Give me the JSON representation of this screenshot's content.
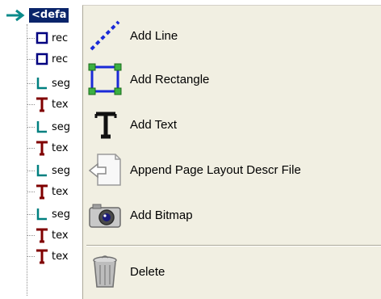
{
  "tree": {
    "root_label": "<defa",
    "rows": [
      {
        "icon": "rect-icon",
        "label": "rec"
      },
      {
        "icon": "rect-icon",
        "label": "rec"
      },
      {
        "icon": "segment-icon",
        "label": "seg"
      },
      {
        "icon": "text-icon",
        "label": "tex"
      },
      {
        "icon": "segment-icon",
        "label": "seg"
      },
      {
        "icon": "text-icon",
        "label": "tex"
      },
      {
        "icon": "segment-icon",
        "label": "seg"
      },
      {
        "icon": "text-icon",
        "label": "tex"
      },
      {
        "icon": "segment-icon",
        "label": "seg"
      },
      {
        "icon": "text-icon",
        "label": "tex"
      },
      {
        "icon": "text-icon",
        "label": "tex"
      }
    ]
  },
  "menu": {
    "items": [
      {
        "label": "Add Line",
        "icon": "line-icon"
      },
      {
        "label": "Add Rectangle",
        "icon": "rectangle-icon"
      },
      {
        "label": "Add Text",
        "icon": "text-icon"
      },
      {
        "label": "Append Page Layout Descr File",
        "icon": "file-append-icon"
      },
      {
        "label": "Add Bitmap",
        "icon": "camera-icon"
      },
      {
        "label": "Delete",
        "icon": "trash-icon"
      }
    ]
  },
  "colors": {
    "selection": "#0a246a",
    "menu_bg": "#f1efe2",
    "rect_blue": "#000080",
    "segment_teal": "#008080",
    "text_red": "#800000"
  }
}
